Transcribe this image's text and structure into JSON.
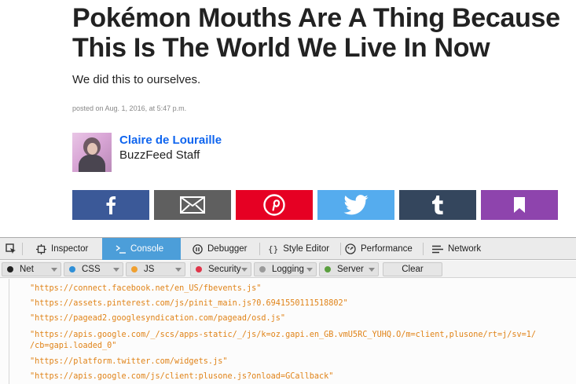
{
  "article": {
    "headline": "Pokémon Mouths Are A Thing Because This Is The World We Live In Now",
    "dek": "We did this to ourselves.",
    "posted": "posted on Aug. 1, 2016, at 5:47 p.m.",
    "author": {
      "name": "Claire de Louraille",
      "role": "BuzzFeed Staff"
    },
    "share": [
      {
        "network": "facebook",
        "icon": "facebook-icon",
        "color": "#3b5998"
      },
      {
        "network": "email",
        "icon": "email-icon",
        "color": "#5f5f5f"
      },
      {
        "network": "pinterest",
        "icon": "pinterest-icon",
        "color": "#e60023"
      },
      {
        "network": "twitter",
        "icon": "twitter-icon",
        "color": "#55acee"
      },
      {
        "network": "tumblr",
        "icon": "tumblr-icon",
        "color": "#34465d"
      },
      {
        "network": "bookmark",
        "icon": "bookmark-icon",
        "color": "#8e44ad"
      }
    ]
  },
  "devtools": {
    "tabs": [
      {
        "label": "",
        "icon": "element-picker-icon"
      },
      {
        "label": "Inspector",
        "icon": "inspector-icon"
      },
      {
        "label": "Console",
        "icon": "console-icon",
        "active": true
      },
      {
        "label": "Debugger",
        "icon": "debugger-icon"
      },
      {
        "label": "Style Editor",
        "icon": "style-editor-icon"
      },
      {
        "label": "Performance",
        "icon": "performance-icon"
      },
      {
        "label": "Network",
        "icon": "network-icon"
      }
    ],
    "filters": [
      {
        "label": "Net",
        "color": "#222222"
      },
      {
        "label": "CSS",
        "color": "#2f8fd7"
      },
      {
        "label": "JS",
        "color": "#f0a030"
      },
      {
        "label": "Security",
        "color": "#e0354a"
      },
      {
        "label": "Logging",
        "color": "#9a9a9a"
      },
      {
        "label": "Server",
        "color": "#5a9f3e"
      }
    ],
    "clear_label": "Clear",
    "accent": "#4c9ed9",
    "log_color": "#e08318",
    "logs": [
      "\"https://connect.facebook.net/en_US/fbevents.js\"",
      "\"https://assets.pinterest.com/js/pinit_main.js?0.6941550111518802\"",
      "\"https://pagead2.googlesyndication.com/pagead/osd.js\"",
      "\"https://apis.google.com/_/scs/apps-static/_/js/k=oz.gapi.en_GB.vmU5RC_YUHQ.O/m=client,plusone/rt=j/sv=1/",
      "/cb=gapi.loaded_0\"",
      "\"https://platform.twitter.com/widgets.js\"",
      "\"https://apis.google.com/js/client:plusone.js?onload=GCallback\""
    ]
  }
}
